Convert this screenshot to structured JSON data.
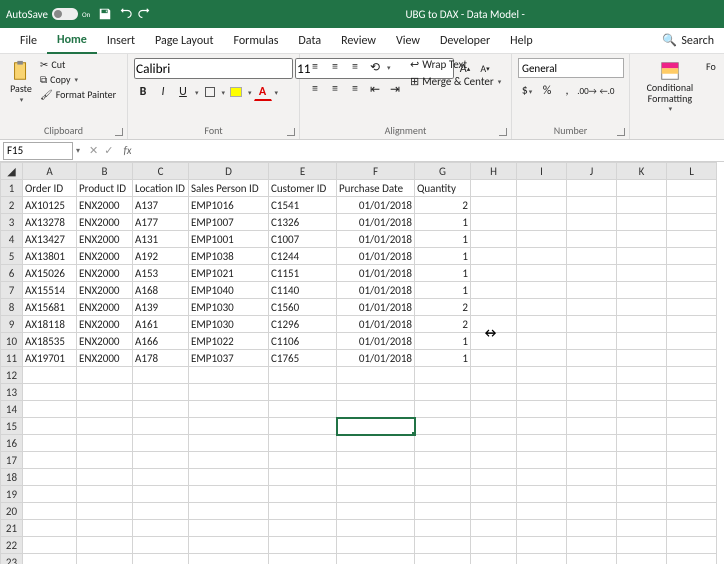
{
  "title_left": "AutoSave",
  "toggle_state": "On",
  "doc_title": "UBG to DAX - Data Model -",
  "menu": {
    "file": "File",
    "home": "Home",
    "insert": "Insert",
    "pagelayout": "Page Layout",
    "formulas": "Formulas",
    "data": "Data",
    "review": "Review",
    "view": "View",
    "developer": "Developer",
    "help": "Help",
    "search": "Search"
  },
  "clipboard": {
    "paste": "Paste",
    "cut": "Cut",
    "copy": "Copy",
    "fpaint": "Format Painter",
    "label": "Clipboard"
  },
  "font": {
    "name": "Calibri",
    "size": "11",
    "bold": "B",
    "italic": "I",
    "underline": "U",
    "incA": "A",
    "decA": "A",
    "label": "Font"
  },
  "alignment": {
    "wraptext": "Wrap Text",
    "merge": "Merge & Center",
    "label": "Alignment"
  },
  "number": {
    "fmt": "General",
    "pct": "%",
    "comma": ",",
    "cur": "$",
    "label": "Number"
  },
  "styles": {
    "cond": "Conditional Formatting",
    "fo": "Fo"
  },
  "namebox": "F15",
  "headers": [
    "A",
    "B",
    "C",
    "D",
    "E",
    "F",
    "G",
    "H",
    "I",
    "J",
    "K",
    "L"
  ],
  "colnames": {
    "a": "Order ID",
    "b": "Product ID",
    "c": "Location ID",
    "d": "Sales Person ID",
    "e": "Customer ID",
    "f": "Purchase Date",
    "g": "Quantity"
  },
  "rows": [
    {
      "a": "AX10125",
      "b": "ENX2000",
      "c": "A137",
      "d": "EMP1016",
      "e": "C1541",
      "f": "01/01/2018",
      "g": "2"
    },
    {
      "a": "AX13278",
      "b": "ENX2000",
      "c": "A177",
      "d": "EMP1007",
      "e": "C1326",
      "f": "01/01/2018",
      "g": "1"
    },
    {
      "a": "AX13427",
      "b": "ENX2000",
      "c": "A131",
      "d": "EMP1001",
      "e": "C1007",
      "f": "01/01/2018",
      "g": "1"
    },
    {
      "a": "AX13801",
      "b": "ENX2000",
      "c": "A192",
      "d": "EMP1038",
      "e": "C1244",
      "f": "01/01/2018",
      "g": "1"
    },
    {
      "a": "AX15026",
      "b": "ENX2000",
      "c": "A153",
      "d": "EMP1021",
      "e": "C1151",
      "f": "01/01/2018",
      "g": "1"
    },
    {
      "a": "AX15514",
      "b": "ENX2000",
      "c": "A168",
      "d": "EMP1040",
      "e": "C1140",
      "f": "01/01/2018",
      "g": "1"
    },
    {
      "a": "AX15681",
      "b": "ENX2000",
      "c": "A139",
      "d": "EMP1030",
      "e": "C1560",
      "f": "01/01/2018",
      "g": "2"
    },
    {
      "a": "AX18118",
      "b": "ENX2000",
      "c": "A161",
      "d": "EMP1030",
      "e": "C1296",
      "f": "01/01/2018",
      "g": "2"
    },
    {
      "a": "AX18535",
      "b": "ENX2000",
      "c": "A166",
      "d": "EMP1022",
      "e": "C1106",
      "f": "01/01/2018",
      "g": "1"
    },
    {
      "a": "AX19701",
      "b": "ENX2000",
      "c": "A178",
      "d": "EMP1037",
      "e": "C1765",
      "f": "01/01/2018",
      "g": "1"
    }
  ],
  "chart_data": {
    "type": "table",
    "columns": [
      "Order ID",
      "Product ID",
      "Location ID",
      "Sales Person ID",
      "Customer ID",
      "Purchase Date",
      "Quantity"
    ],
    "data": [
      [
        "AX10125",
        "ENX2000",
        "A137",
        "EMP1016",
        "C1541",
        "01/01/2018",
        2
      ],
      [
        "AX13278",
        "ENX2000",
        "A177",
        "EMP1007",
        "C1326",
        "01/01/2018",
        1
      ],
      [
        "AX13427",
        "ENX2000",
        "A131",
        "EMP1001",
        "C1007",
        "01/01/2018",
        1
      ],
      [
        "AX13801",
        "ENX2000",
        "A192",
        "EMP1038",
        "C1244",
        "01/01/2018",
        1
      ],
      [
        "AX15026",
        "ENX2000",
        "A153",
        "EMP1021",
        "C1151",
        "01/01/2018",
        1
      ],
      [
        "AX15514",
        "ENX2000",
        "A168",
        "EMP1040",
        "C1140",
        "01/01/2018",
        1
      ],
      [
        "AX15681",
        "ENX2000",
        "A139",
        "EMP1030",
        "C1560",
        "01/01/2018",
        2
      ],
      [
        "AX18118",
        "ENX2000",
        "A161",
        "EMP1030",
        "C1296",
        "01/01/2018",
        2
      ],
      [
        "AX18535",
        "ENX2000",
        "A166",
        "EMP1022",
        "C1106",
        "01/01/2018",
        1
      ],
      [
        "AX19701",
        "ENX2000",
        "A178",
        "EMP1037",
        "C1765",
        "01/01/2018",
        1
      ]
    ]
  }
}
